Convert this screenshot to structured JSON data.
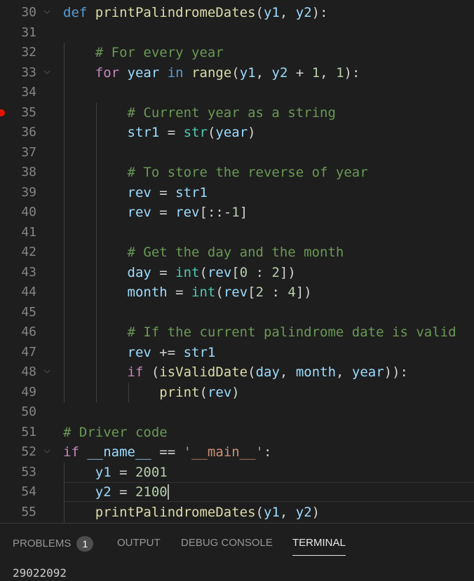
{
  "editor": {
    "lines": [
      {
        "num": "30",
        "fold": true,
        "tokens": [
          [
            "kw",
            "def "
          ],
          [
            "fn",
            "printPalindromeDates"
          ],
          [
            "op",
            "("
          ],
          [
            "var",
            "y1"
          ],
          [
            "op",
            ", "
          ],
          [
            "var",
            "y2"
          ],
          [
            "op",
            "):"
          ]
        ]
      },
      {
        "num": "31",
        "tokens": []
      },
      {
        "num": "32",
        "tokens": [
          [
            "op",
            "    "
          ],
          [
            "cmt",
            "# For every year"
          ]
        ]
      },
      {
        "num": "33",
        "fold": true,
        "tokens": [
          [
            "op",
            "    "
          ],
          [
            "ctl",
            "for "
          ],
          [
            "var",
            "year"
          ],
          [
            "kw",
            " in "
          ],
          [
            "fn",
            "range"
          ],
          [
            "op",
            "("
          ],
          [
            "var",
            "y1"
          ],
          [
            "op",
            ", "
          ],
          [
            "var",
            "y2"
          ],
          [
            "op",
            " + "
          ],
          [
            "num",
            "1"
          ],
          [
            "op",
            ", "
          ],
          [
            "num",
            "1"
          ],
          [
            "op",
            "):"
          ]
        ]
      },
      {
        "num": "34",
        "tokens": []
      },
      {
        "num": "35",
        "breakpoint": true,
        "tokens": [
          [
            "op",
            "        "
          ],
          [
            "cmt",
            "# Current year as a string"
          ]
        ]
      },
      {
        "num": "36",
        "tokens": [
          [
            "op",
            "        "
          ],
          [
            "var",
            "str1"
          ],
          [
            "op",
            " = "
          ],
          [
            "bi",
            "str"
          ],
          [
            "op",
            "("
          ],
          [
            "var",
            "year"
          ],
          [
            "op",
            ")"
          ]
        ]
      },
      {
        "num": "37",
        "tokens": []
      },
      {
        "num": "38",
        "tokens": [
          [
            "op",
            "        "
          ],
          [
            "cmt",
            "# To store the reverse of year"
          ]
        ]
      },
      {
        "num": "39",
        "tokens": [
          [
            "op",
            "        "
          ],
          [
            "var",
            "rev"
          ],
          [
            "op",
            " = "
          ],
          [
            "var",
            "str1"
          ]
        ]
      },
      {
        "num": "40",
        "tokens": [
          [
            "op",
            "        "
          ],
          [
            "var",
            "rev"
          ],
          [
            "op",
            " = "
          ],
          [
            "var",
            "rev"
          ],
          [
            "op",
            "[::-"
          ],
          [
            "num",
            "1"
          ],
          [
            "op",
            "]"
          ]
        ]
      },
      {
        "num": "41",
        "tokens": []
      },
      {
        "num": "42",
        "tokens": [
          [
            "op",
            "        "
          ],
          [
            "cmt",
            "# Get the day and the month"
          ]
        ]
      },
      {
        "num": "43",
        "tokens": [
          [
            "op",
            "        "
          ],
          [
            "var",
            "day"
          ],
          [
            "op",
            " = "
          ],
          [
            "bi",
            "int"
          ],
          [
            "op",
            "("
          ],
          [
            "var",
            "rev"
          ],
          [
            "op",
            "["
          ],
          [
            "num",
            "0"
          ],
          [
            "op",
            " : "
          ],
          [
            "num",
            "2"
          ],
          [
            "op",
            "])"
          ]
        ]
      },
      {
        "num": "44",
        "tokens": [
          [
            "op",
            "        "
          ],
          [
            "var",
            "month"
          ],
          [
            "op",
            " = "
          ],
          [
            "bi",
            "int"
          ],
          [
            "op",
            "("
          ],
          [
            "var",
            "rev"
          ],
          [
            "op",
            "["
          ],
          [
            "num",
            "2"
          ],
          [
            "op",
            " : "
          ],
          [
            "num",
            "4"
          ],
          [
            "op",
            "])"
          ]
        ]
      },
      {
        "num": "45",
        "tokens": []
      },
      {
        "num": "46",
        "tokens": [
          [
            "op",
            "        "
          ],
          [
            "cmt",
            "# If the current palindrome date is valid"
          ]
        ]
      },
      {
        "num": "47",
        "tokens": [
          [
            "op",
            "        "
          ],
          [
            "var",
            "rev"
          ],
          [
            "op",
            " += "
          ],
          [
            "var",
            "str1"
          ]
        ]
      },
      {
        "num": "48",
        "fold": true,
        "tokens": [
          [
            "op",
            "        "
          ],
          [
            "ctl",
            "if "
          ],
          [
            "op",
            "("
          ],
          [
            "fn",
            "isValidDate"
          ],
          [
            "op",
            "("
          ],
          [
            "var",
            "day"
          ],
          [
            "op",
            ", "
          ],
          [
            "var",
            "month"
          ],
          [
            "op",
            ", "
          ],
          [
            "var",
            "year"
          ],
          [
            "op",
            ")):"
          ]
        ]
      },
      {
        "num": "49",
        "tokens": [
          [
            "op",
            "            "
          ],
          [
            "fn",
            "print"
          ],
          [
            "op",
            "("
          ],
          [
            "var",
            "rev"
          ],
          [
            "op",
            ")"
          ]
        ]
      },
      {
        "num": "50",
        "tokens": []
      },
      {
        "num": "51",
        "tokens": [
          [
            "cmt",
            "# Driver code"
          ]
        ]
      },
      {
        "num": "52",
        "fold": true,
        "tokens": [
          [
            "ctl",
            "if "
          ],
          [
            "var",
            "__name__"
          ],
          [
            "op",
            " == "
          ],
          [
            "str",
            "'__main__'"
          ],
          [
            "op",
            ":"
          ]
        ]
      },
      {
        "num": "53",
        "tokens": [
          [
            "op",
            "    "
          ],
          [
            "var",
            "y1"
          ],
          [
            "op",
            " = "
          ],
          [
            "num",
            "2001"
          ]
        ]
      },
      {
        "num": "54",
        "current": true,
        "tokens": [
          [
            "op",
            "    "
          ],
          [
            "var",
            "y2"
          ],
          [
            "op",
            " = "
          ],
          [
            "num",
            "2100"
          ]
        ]
      },
      {
        "num": "55",
        "tokens": [
          [
            "op",
            "    "
          ],
          [
            "fn",
            "printPalindromeDates"
          ],
          [
            "op",
            "("
          ],
          [
            "var",
            "y1"
          ],
          [
            "op",
            ", "
          ],
          [
            "var",
            "y2"
          ],
          [
            "op",
            ")"
          ]
        ]
      }
    ]
  },
  "panel": {
    "tabs": {
      "problems": "PROBLEMS",
      "problems_count": "1",
      "output": "OUTPUT",
      "debug_console": "DEBUG CONSOLE",
      "terminal": "TERMINAL"
    },
    "terminal_output": "29022092"
  },
  "colors": {
    "background": "#1e1e1e",
    "keyword": "#569cd6",
    "control": "#c586c0",
    "function": "#dcdcaa",
    "variable": "#9cdcfe",
    "number": "#b5cea8",
    "string": "#ce9178",
    "comment": "#6a9955",
    "builtin": "#4ec9b0",
    "breakpoint": "#e51400"
  }
}
